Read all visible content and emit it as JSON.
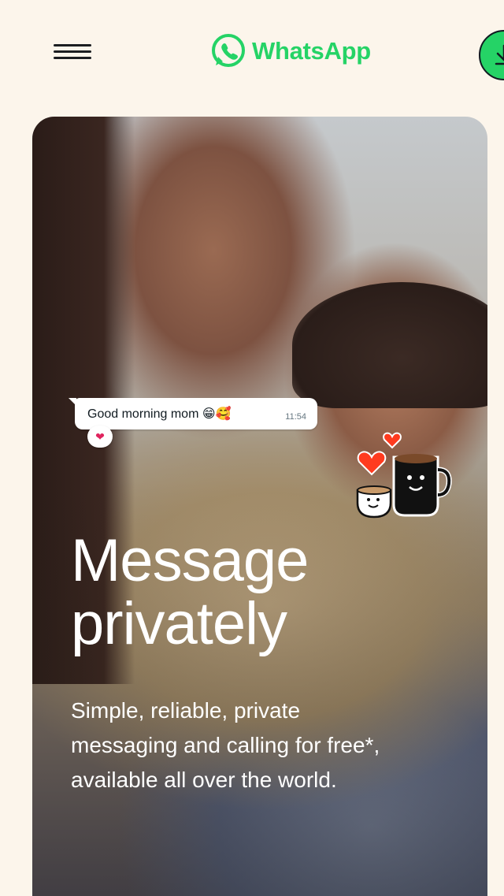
{
  "header": {
    "logo_text": "WhatsApp",
    "brand_color": "#25d366"
  },
  "hero": {
    "chat_bubble": {
      "message": "Good morning mom 😁🥰",
      "time": "11:54",
      "reaction": "❤"
    },
    "headline_line1": "Message",
    "headline_line2": "privately",
    "subtext": "Simple, reliable, private messaging and calling for free*, available all over the world."
  },
  "icons": {
    "menu": "hamburger-menu-icon",
    "logo": "whatsapp-logo-icon",
    "download": "download-icon"
  }
}
